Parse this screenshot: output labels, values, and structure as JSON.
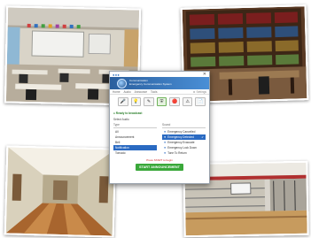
{
  "window": {
    "close_glyph": "✕",
    "banner_line1": "Communication",
    "banner_line2": "Emergency Communication System"
  },
  "nav": {
    "items": [
      "Home",
      "Audio",
      "Announce",
      "Tools"
    ],
    "right": "⚙ Settings"
  },
  "toolbar_icons": [
    {
      "name": "microphone-icon",
      "glyph": "🎤"
    },
    {
      "name": "lightbulb-icon",
      "glyph": "💡"
    },
    {
      "name": "pencil-icon",
      "glyph": "✎"
    },
    {
      "name": "shield-icon",
      "glyph": "⛨"
    },
    {
      "name": "alarm-icon",
      "glyph": "🔴"
    },
    {
      "name": "warning-icon",
      "glyph": "⚠"
    },
    {
      "name": "document-icon",
      "glyph": "📄"
    }
  ],
  "status": "● Ready to broadcast",
  "section_label": "Select Audio",
  "type_column": {
    "header": "Type",
    "items": [
      "All",
      "Announcement",
      "Bell",
      "Notification",
      "Tornado"
    ],
    "selected_index": 3
  },
  "sound_column": {
    "header": "Sound",
    "items": [
      "Emergency Cancelled",
      "Emergency Detected",
      "Emergency Evacuate",
      "Emergency Lock Down",
      "Tone To Return"
    ],
    "selected_index": 1,
    "check_glyph": "✔"
  },
  "prompt": "Press START to begin",
  "start_button": "START ANNOUNCEMENT"
}
